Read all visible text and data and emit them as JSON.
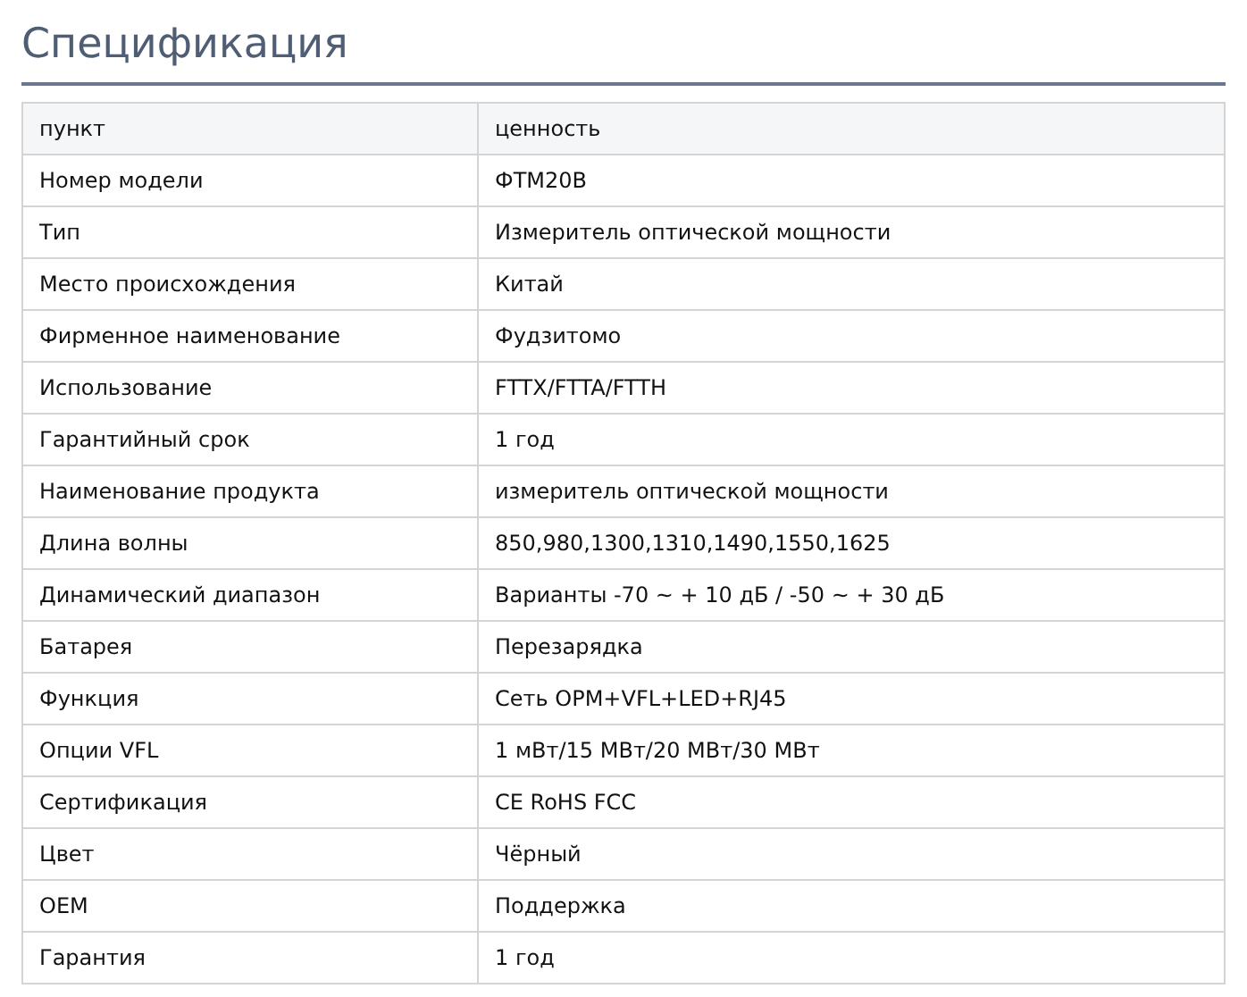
{
  "title": "Спецификация",
  "table": {
    "columns": [
      "пункт",
      "ценность"
    ],
    "rows": [
      [
        "Номер модели",
        "ФТМ20В"
      ],
      [
        "Тип",
        "Измеритель оптической мощности"
      ],
      [
        "Место происхождения",
        "Китай"
      ],
      [
        "Фирменное наименование",
        "Фудзитомо"
      ],
      [
        "Использование",
        "FTTX/FTTA/FTTH"
      ],
      [
        "Гарантийный срок",
        "1 год"
      ],
      [
        "Наименование продукта",
        "измеритель оптической мощности"
      ],
      [
        "Длина волны",
        "850,980,1300,1310,1490,1550,1625"
      ],
      [
        "Динамический диапазон",
        "Варианты -70 ~ + 10 дБ / -50 ~ + 30 дБ"
      ],
      [
        "Батарея",
        "Перезарядка"
      ],
      [
        "Функция",
        "Сеть OPM+VFL+LED+RJ45"
      ],
      [
        "Опции VFL",
        "1 мВт/15 МВт/20 МВт/30 МВт"
      ],
      [
        "Сертификация",
        "CE RoHS FCC"
      ],
      [
        "Цвет",
        "Чёрный"
      ],
      [
        "OEM",
        "Поддержка"
      ],
      [
        "Гарантия",
        "1 год"
      ]
    ]
  }
}
